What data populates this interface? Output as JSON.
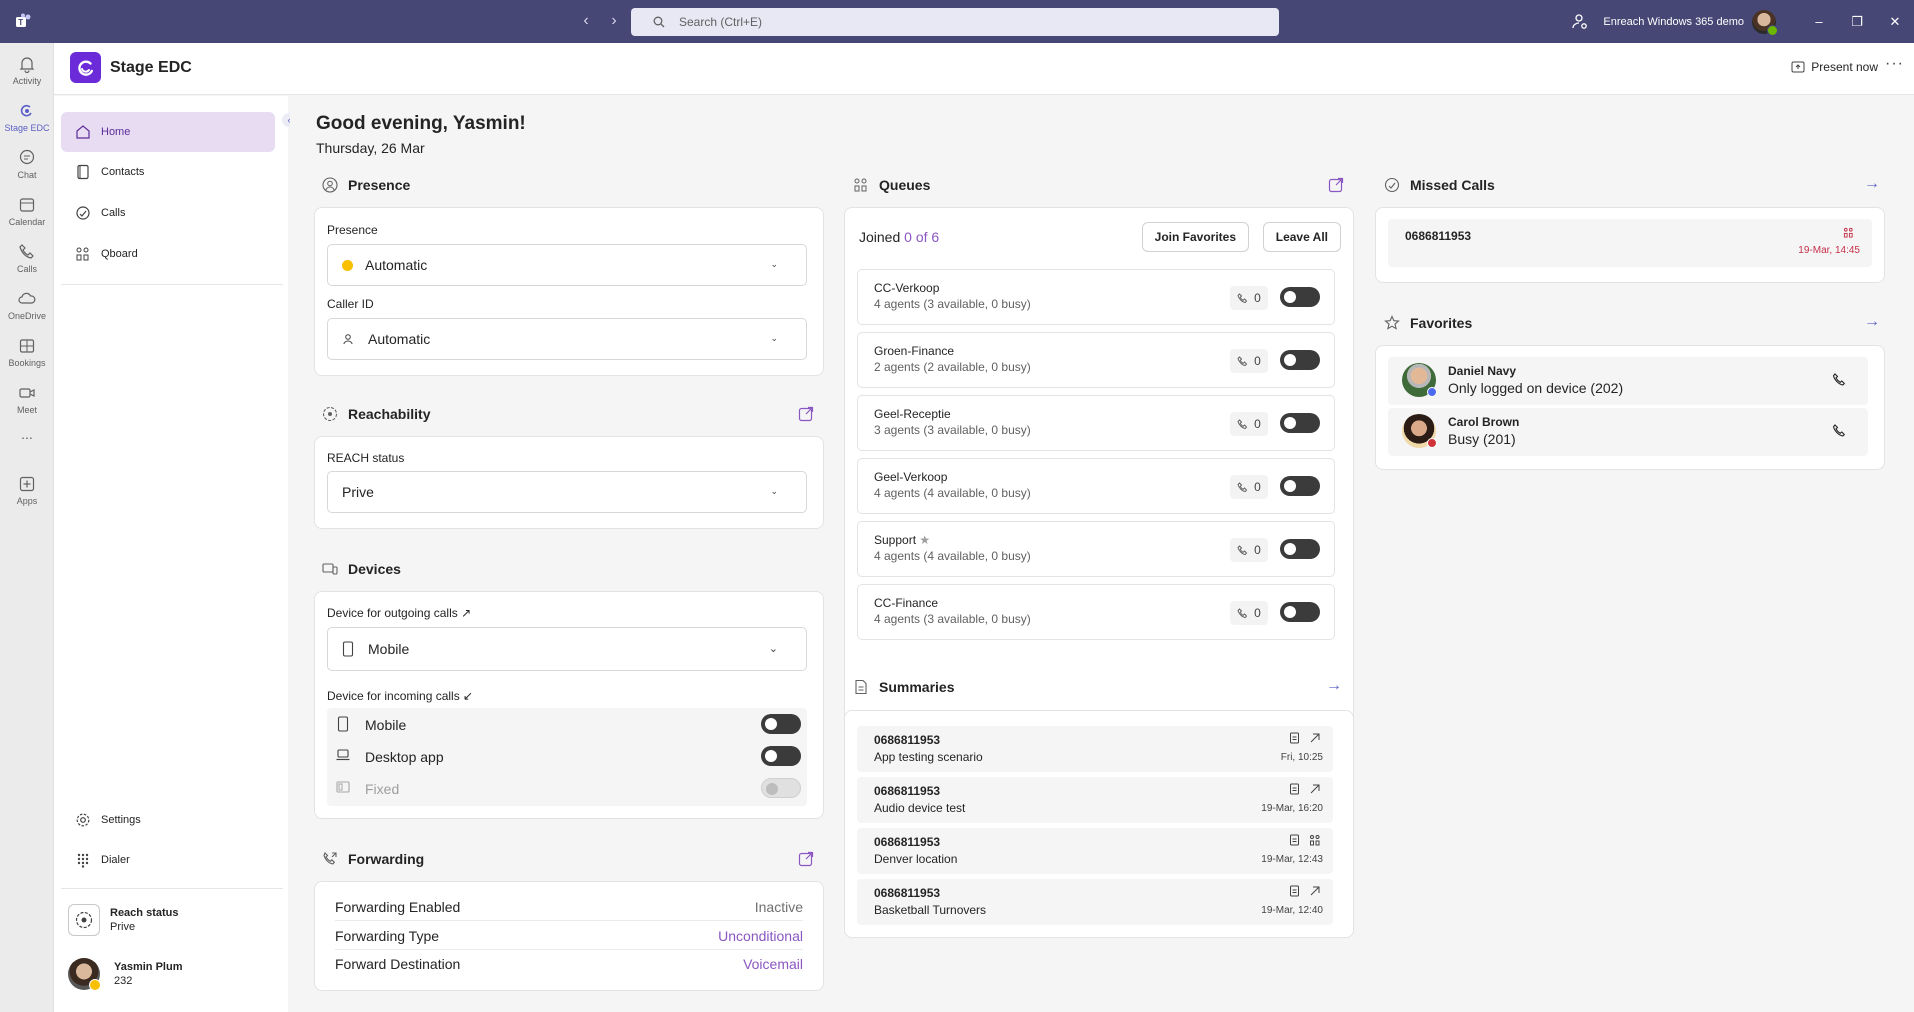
{
  "titlebar": {
    "search_placeholder": "Search (Ctrl+E)",
    "org_name": "Enreach Windows 365 demo",
    "minimize": "–",
    "restore": "❐",
    "close": "✕"
  },
  "rail": {
    "items": [
      {
        "label": "Activity",
        "icon": "bell-icon"
      },
      {
        "label": "Stage EDC",
        "icon": "app-icon"
      },
      {
        "label": "Chat",
        "icon": "chat-icon"
      },
      {
        "label": "Calendar",
        "icon": "calendar-icon"
      },
      {
        "label": "Calls",
        "icon": "phone-icon"
      },
      {
        "label": "OneDrive",
        "icon": "cloud-icon"
      },
      {
        "label": "Bookings",
        "icon": "bookings-icon"
      },
      {
        "label": "Meet",
        "icon": "video-icon"
      },
      {
        "label": "...",
        "icon": "more-icon"
      },
      {
        "label": "Apps",
        "icon": "plus-icon"
      }
    ]
  },
  "header": {
    "app_title": "Stage EDC",
    "present_now": "Present now"
  },
  "sidenav": {
    "items": [
      {
        "label": "Home"
      },
      {
        "label": "Contacts"
      },
      {
        "label": "Calls"
      },
      {
        "label": "Qboard"
      }
    ],
    "settings": "Settings",
    "dialer": "Dialer",
    "reach_status_title": "Reach status",
    "reach_status_value": "Prive",
    "user_name": "Yasmin Plum",
    "user_ext": "232"
  },
  "main": {
    "greeting": "Good evening, Yasmin!",
    "date": "Thursday, 26 Mar"
  },
  "presence": {
    "title": "Presence",
    "presence_label": "Presence",
    "presence_value": "Automatic",
    "caller_id_label": "Caller ID",
    "caller_id_value": "Automatic"
  },
  "reachability": {
    "title": "Reachability",
    "status_label": "REACH status",
    "status_value": "Prive"
  },
  "devices": {
    "title": "Devices",
    "outgoing_label": "Device for outgoing calls ↗",
    "outgoing_value": "Mobile",
    "incoming_label": "Device for incoming calls ↙",
    "incoming": [
      {
        "name": "Mobile",
        "on": false,
        "disabled": false
      },
      {
        "name": "Desktop app",
        "on": false,
        "disabled": false
      },
      {
        "name": "Fixed",
        "on": false,
        "disabled": true
      }
    ]
  },
  "forwarding": {
    "title": "Forwarding",
    "rows": [
      {
        "label": "Forwarding Enabled",
        "value": "Inactive"
      },
      {
        "label": "Forwarding Type",
        "value": "Unconditional"
      },
      {
        "label": "Forward Destination",
        "value": "Voicemail"
      }
    ]
  },
  "queues": {
    "title": "Queues",
    "joined_prefix": "Joined",
    "joined_value": "0 of 6",
    "join_favorites": "Join Favorites",
    "leave_all": "Leave All",
    "items": [
      {
        "name": "CC-Verkoop",
        "sub": "4 agents (3 available, 0 busy)",
        "count": "0",
        "star": false
      },
      {
        "name": "Groen-Finance",
        "sub": "2 agents (2 available, 0 busy)",
        "count": "0",
        "star": false
      },
      {
        "name": "Geel-Receptie",
        "sub": "3 agents (3 available, 0 busy)",
        "count": "0",
        "star": false
      },
      {
        "name": "Geel-Verkoop",
        "sub": "4 agents (4 available, 0 busy)",
        "count": "0",
        "star": false
      },
      {
        "name": "Support",
        "sub": "4 agents (4 available, 0 busy)",
        "count": "0",
        "star": true
      },
      {
        "name": "CC-Finance",
        "sub": "4 agents (3 available, 0 busy)",
        "count": "0",
        "star": false
      }
    ]
  },
  "summaries": {
    "title": "Summaries",
    "items": [
      {
        "number": "0686811953",
        "desc": "App testing scenario",
        "time": "Fri, 10:25",
        "icon2": "outgoing-arrow-icon"
      },
      {
        "number": "0686811953",
        "desc": "Audio device test",
        "time": "19-Mar, 16:20",
        "icon2": "outgoing-arrow-icon"
      },
      {
        "number": "0686811953",
        "desc": "Denver location",
        "time": "19-Mar, 12:43",
        "icon2": "queue-icon"
      },
      {
        "number": "0686811953",
        "desc": "Basketball Turnovers",
        "time": "19-Mar, 12:40",
        "icon2": "outgoing-arrow-icon"
      }
    ]
  },
  "missed_calls": {
    "title": "Missed Calls",
    "items": [
      {
        "number": "0686811953",
        "time": "19-Mar, 14:45"
      }
    ]
  },
  "favorites": {
    "title": "Favorites",
    "items": [
      {
        "name": "Daniel Navy",
        "status": "Only logged on device (202)",
        "status_color": "#4f6bed"
      },
      {
        "name": "Carol Brown",
        "status": "Busy (201)",
        "status_color": "#d13438"
      }
    ]
  },
  "colors": {
    "accent": "#5b5fc7",
    "brand_purple": "#6c2bd9",
    "titlebar": "#464775",
    "missed_red": "#c4314b"
  }
}
